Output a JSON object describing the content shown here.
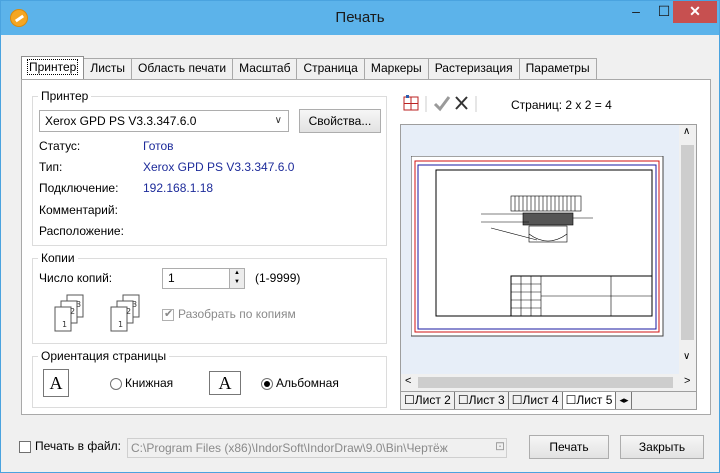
{
  "window": {
    "title": "Печать"
  },
  "tabs": [
    "Принтер",
    "Листы",
    "Область печати",
    "Масштаб",
    "Страница",
    "Маркеры",
    "Растеризация",
    "Параметры"
  ],
  "printer": {
    "group_label": "Принтер",
    "selected": "Xerox GPD PS V3.3.347.6.0",
    "properties_button": "Свойства...",
    "status_label": "Статус:",
    "status_value": "Готов",
    "type_label": "Тип:",
    "type_value": "Xerox GPD PS V3.3.347.6.0",
    "connection_label": "Подключение:",
    "connection_value": "192.168.1.18",
    "comment_label": "Комментарий:",
    "location_label": "Расположение:"
  },
  "copies": {
    "group_label": "Копии",
    "count_label": "Число копий:",
    "count_value": "1",
    "range_hint": "(1-9999)",
    "collate_label": "Разобрать по копиям",
    "collate_checked": true
  },
  "orientation": {
    "group_label": "Ориентация страницы",
    "portrait_label": "Книжная",
    "landscape_label": "Альбомная",
    "selected": "landscape",
    "icon_letter": "A"
  },
  "preview": {
    "pages_label": "Страниц: 2 x 2 = 4",
    "sheet_tabs": [
      "Лист 2",
      "Лист 3",
      "Лист 4",
      "Лист 5"
    ],
    "active_sheet": "Лист 5"
  },
  "bottom": {
    "print_to_file_label": "Печать в файл:",
    "print_to_file_checked": false,
    "file_path": "C:\\Program Files (x86)\\IndorSoft\\IndorDraw\\9.0\\Bin\\Чертёж",
    "print_button": "Печать",
    "close_button": "Закрыть"
  }
}
